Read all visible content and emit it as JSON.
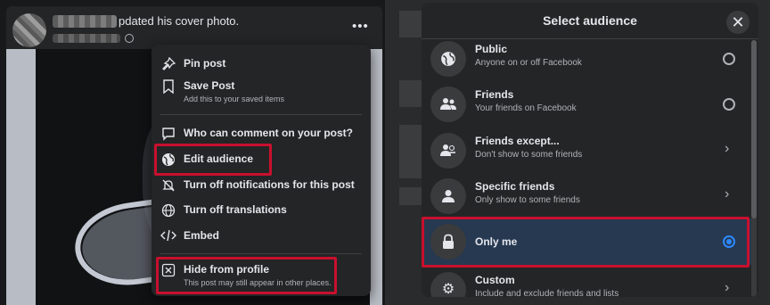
{
  "post": {
    "action_text": "pdated his cover photo.",
    "more_icon": "more-horizontal-icon"
  },
  "menu": {
    "items": [
      {
        "label": "Pin post",
        "icon": "pin-icon"
      },
      {
        "label": "Save Post",
        "sub": "Add this to your saved items",
        "icon": "bookmark-icon"
      },
      {
        "label": "Who can comment on your post?",
        "icon": "comment-icon"
      },
      {
        "label": "Edit audience",
        "icon": "globe-icon"
      },
      {
        "label": "Turn off notifications for this post",
        "icon": "bell-off-icon"
      },
      {
        "label": "Turn off translations",
        "icon": "translate-icon"
      },
      {
        "label": "Embed",
        "icon": "code-icon"
      },
      {
        "label": "Hide from profile",
        "sub": "This post may still appear in other places.",
        "icon": "hide-icon"
      }
    ]
  },
  "modal": {
    "title": "Select audience",
    "close_icon": "close-icon",
    "options": [
      {
        "title": "Public",
        "sub": "Anyone on or off Facebook",
        "icon": "globe-icon",
        "control": "radio",
        "selected": false
      },
      {
        "title": "Friends",
        "sub": "Your friends on Facebook",
        "icon": "friends-icon",
        "control": "radio",
        "selected": false
      },
      {
        "title": "Friends except...",
        "sub": "Don't show to some friends",
        "icon": "friends-except-icon",
        "control": "chevron"
      },
      {
        "title": "Specific friends",
        "sub": "Only show to some friends",
        "icon": "person-icon",
        "control": "chevron"
      },
      {
        "title": "Only me",
        "sub": "",
        "icon": "lock-icon",
        "control": "radio",
        "selected": true
      },
      {
        "title": "Custom",
        "sub": "Include and exclude friends and lists",
        "icon": "gear-icon",
        "control": "chevron"
      }
    ]
  },
  "colors": {
    "highlight": "#c8102e",
    "accent": "#2d88ff",
    "panel": "#242526"
  }
}
